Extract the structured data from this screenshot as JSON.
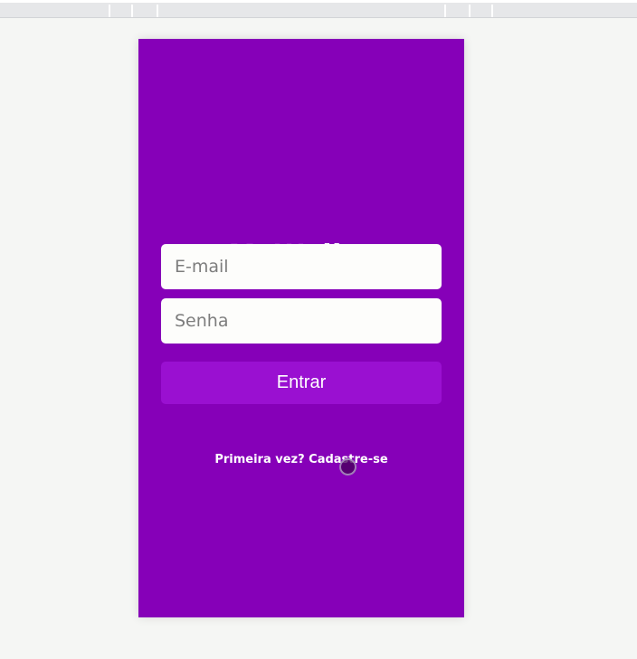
{
  "app": {
    "logo_text": "MyWallet"
  },
  "login_form": {
    "email_placeholder": "E-mail",
    "password_placeholder": "Senha",
    "submit_label": "Entrar",
    "signup_link": "Primeira vez? Cadastre-se"
  },
  "colors": {
    "background": "#8600b8",
    "button": "#9a10d1",
    "page": "#f5f6f4"
  }
}
